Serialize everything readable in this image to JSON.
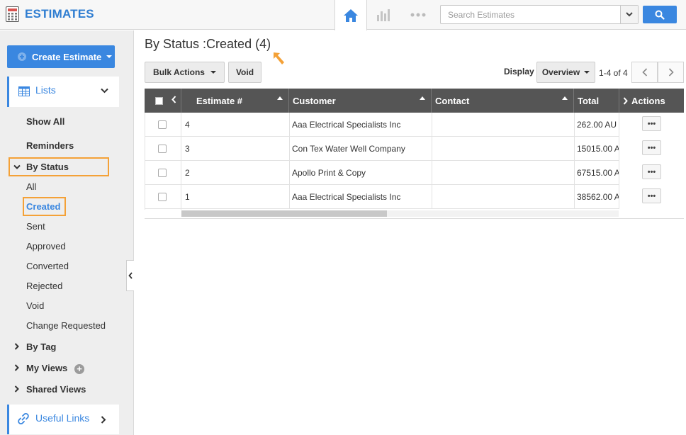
{
  "app": {
    "title": "ESTIMATES"
  },
  "search": {
    "placeholder": "Search Estimates"
  },
  "sidebar": {
    "create_label": "Create Estimate",
    "lists_label": "Lists",
    "show_all": "Show All",
    "reminders": "Reminders",
    "by_status": "By Status",
    "status_items": [
      "All",
      "Created",
      "Sent",
      "Approved",
      "Converted",
      "Rejected",
      "Void",
      "Change Requested"
    ],
    "by_tag": "By Tag",
    "my_views": "My Views",
    "shared_views": "Shared Views",
    "useful_links": "Useful Links"
  },
  "main": {
    "title": "By Status :Created (4)",
    "bulk_actions": "Bulk Actions",
    "void": "Void",
    "display_label": "Display",
    "display_value": "Overview",
    "pager": "1-4 of 4"
  },
  "table": {
    "columns": [
      "Estimate #",
      "Customer",
      "Contact",
      "Total",
      "Actions"
    ],
    "rows": [
      {
        "estimate": "4",
        "customer": "Aaa Electrical Specialists Inc",
        "contact": "",
        "total": "262.00  AU"
      },
      {
        "estimate": "3",
        "customer": "Con Tex Water Well Company",
        "contact": "",
        "total": "15015.00  A"
      },
      {
        "estimate": "2",
        "customer": "Apollo Print & Copy",
        "contact": "",
        "total": "67515.00  A"
      },
      {
        "estimate": "1",
        "customer": "Aaa Electrical Specialists Inc",
        "contact": "",
        "total": "38562.00  A"
      }
    ],
    "row_action": "•••"
  },
  "colors": {
    "accent": "#3a87e0",
    "highlight": "#f4a137",
    "header": "#555555"
  }
}
